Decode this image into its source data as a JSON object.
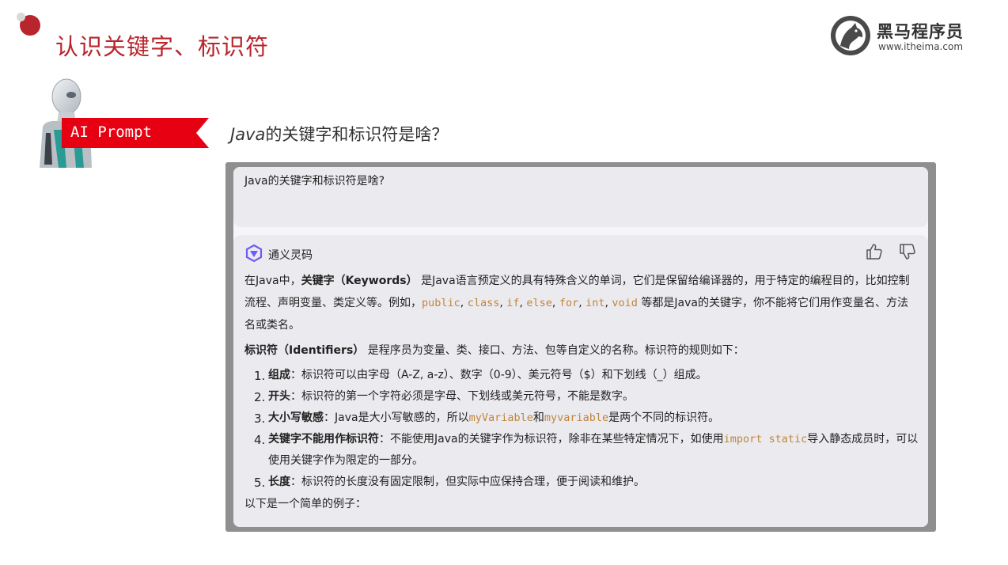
{
  "slide": {
    "title": "认识关键字、标识符"
  },
  "logo": {
    "name": "黑马程序员",
    "url": "www.itheima.com"
  },
  "prompt_tag": {
    "label": "AI Prompt"
  },
  "question": {
    "java": "Java",
    "rest": "的关键字和标识符是啥？"
  },
  "chat": {
    "user_message": "Java的关键字和标识符是啥?",
    "assistant_name": "通义灵码",
    "para1": {
      "pre": "在Java中，",
      "term": "关键字（Keywords）",
      "mid": " 是Java语言预定义的具有特殊含义的单词，它们是保留给编译器的，用于特定的编程目的，比如控制流程、声明变量、类定义等。例如，",
      "keywords": [
        "public",
        "class",
        "if",
        "else",
        "for",
        "int",
        "void"
      ],
      "post": " 等都是Java的关键字，你不能将它们用作变量名、方法名或类名。"
    },
    "para2": {
      "term": "标识符（Identifiers）",
      "rest": " 是程序员为变量、类、接口、方法、包等自定义的名称。标识符的规则如下："
    },
    "rules": [
      {
        "num": "1.",
        "title": "组成",
        "text": "：标识符可以由字母（A-Z, a-z）、数字（0-9）、美元符号（$）和下划线（_）组成。"
      },
      {
        "num": "2.",
        "title": "开头",
        "text": "：标识符的第一个字符必须是字母、下划线或美元符号，不能是数字。"
      },
      {
        "num": "3.",
        "title": "大小写敏感",
        "text_a": "：Java是大小写敏感的，所以",
        "code_a": "myVariable",
        "text_b": "和",
        "code_b": "myvariable",
        "text_c": "是两个不同的标识符。"
      },
      {
        "num": "4.",
        "title": "关键字不能用作标识符",
        "text_a": "：不能使用Java的关键字作为标识符，除非在某些特定情况下，如使用",
        "code_a": "import static",
        "text_b": "导入静态成员时，可以使用关键字作为限定的一部分。"
      },
      {
        "num": "5.",
        "title": "长度",
        "text": "：标识符的长度没有固定限制，但实际中应保持合理，便于阅读和维护。"
      }
    ],
    "closing": "以下是一个简单的例子："
  },
  "colors": {
    "accent_red": "#b8252c",
    "code_orange": "#c1843d",
    "tag_red": "#e60012",
    "frame_gray": "#8f8f8f"
  },
  "icons": [
    "robot-illustration",
    "horse-logo-icon",
    "tongyi-logo-icon",
    "thumbs-up-icon",
    "thumbs-down-icon"
  ]
}
